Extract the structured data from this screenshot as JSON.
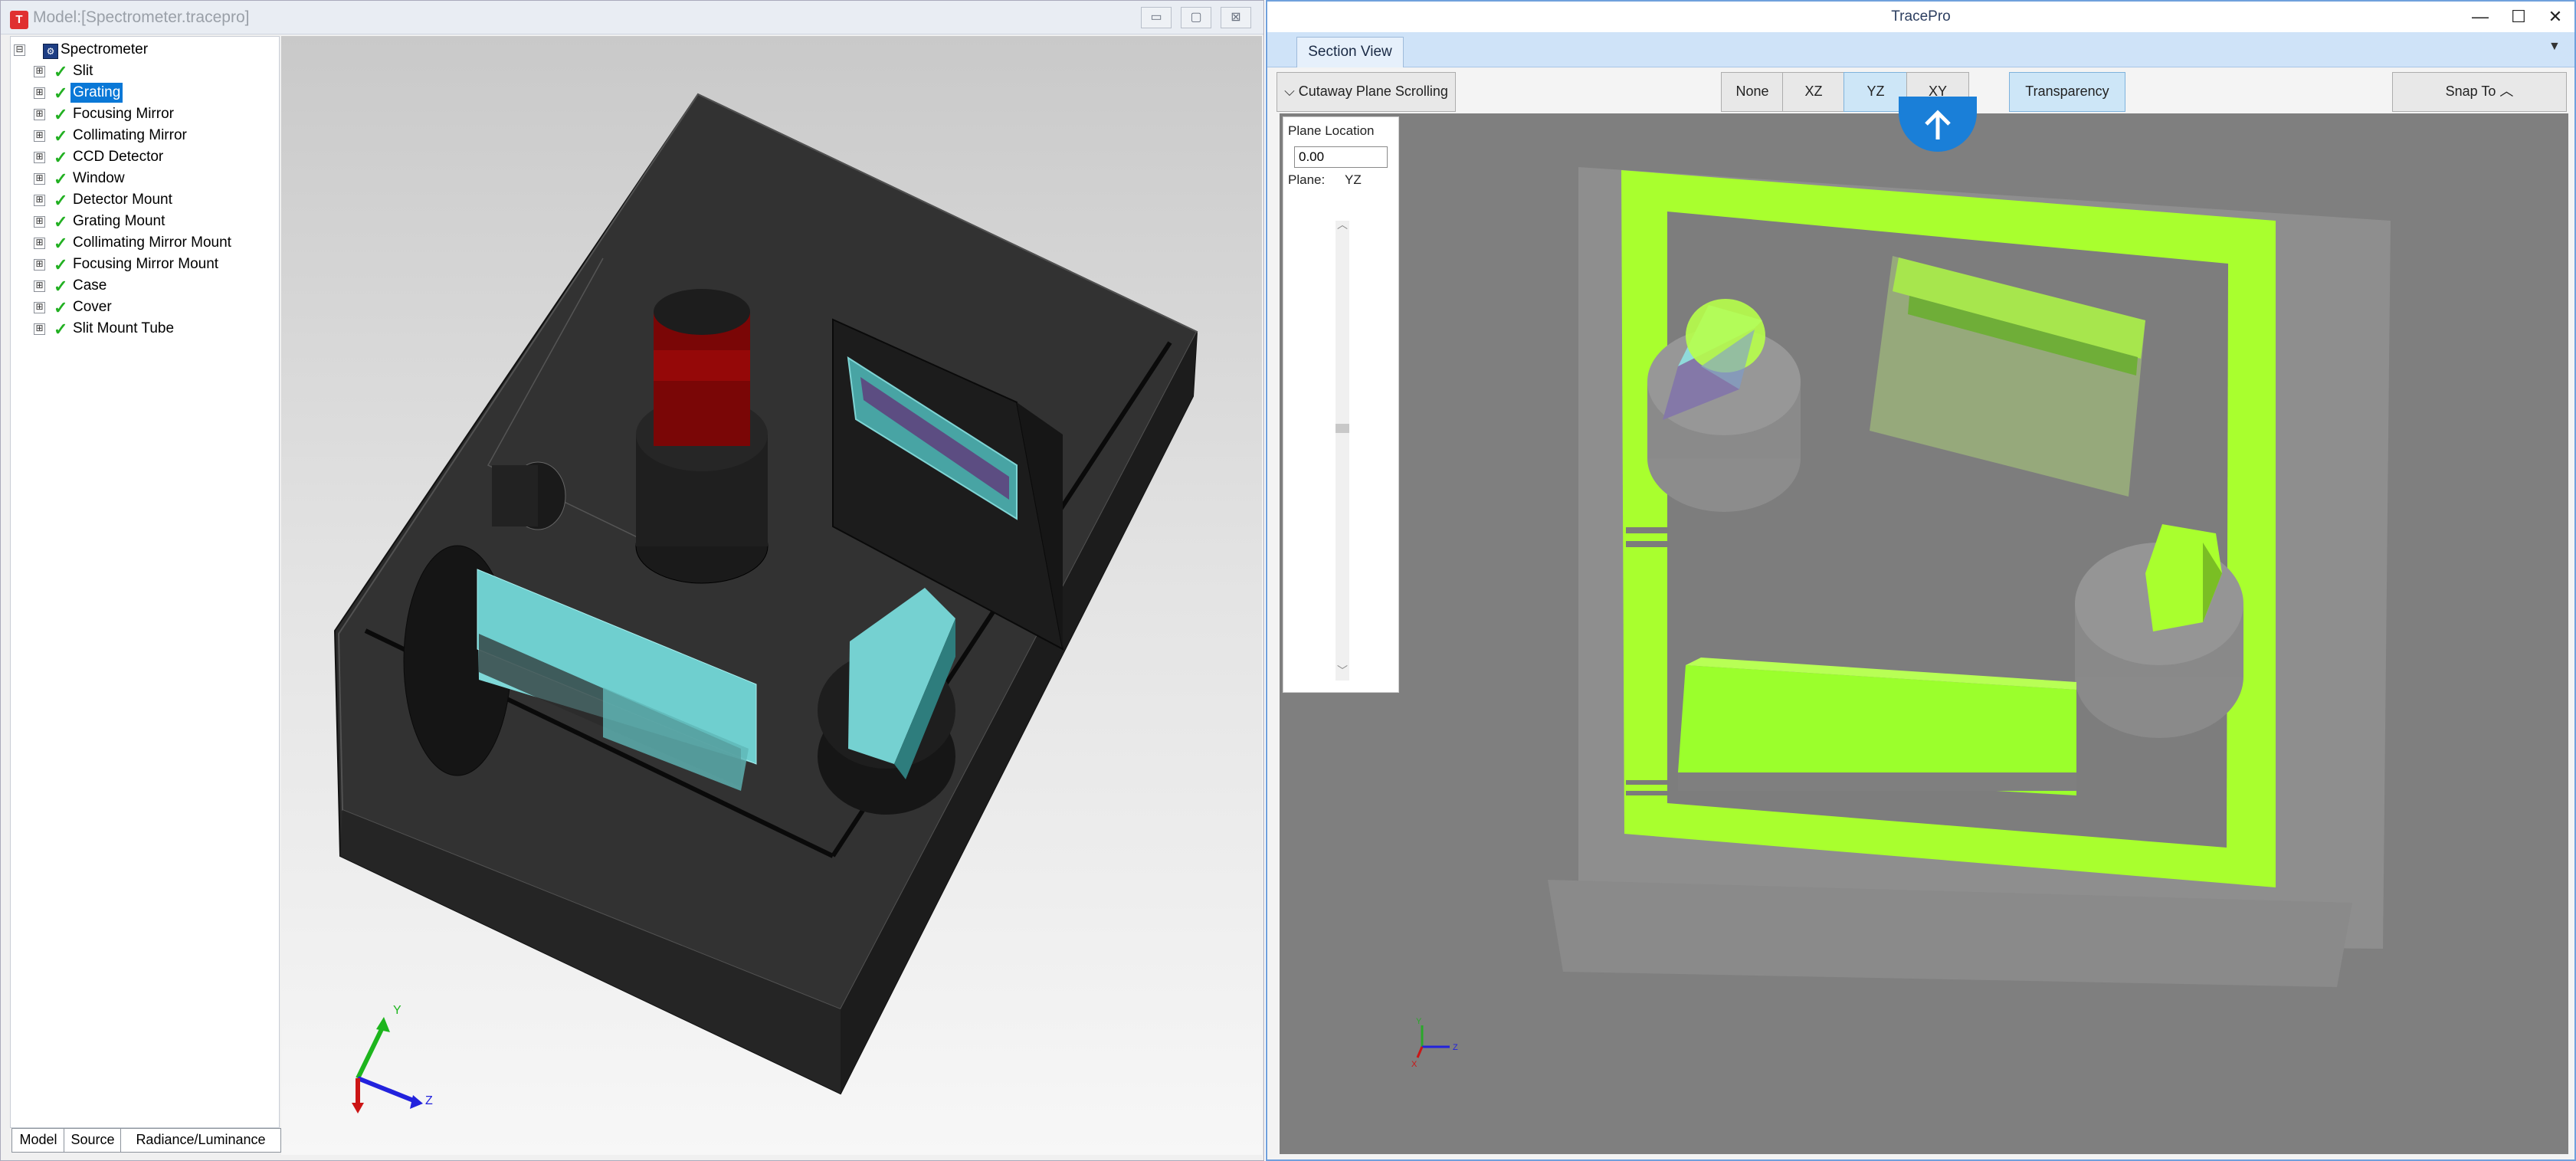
{
  "left_window": {
    "title": "Model:[Spectrometer.tracepro]",
    "app_icon": "tracepro-icon",
    "controls": {
      "minimize": "▭",
      "restore": "▢",
      "close": "⊠"
    }
  },
  "tree": {
    "root": "Spectrometer",
    "items": [
      {
        "label": "Slit",
        "selected": false
      },
      {
        "label": "Grating",
        "selected": true
      },
      {
        "label": "Focusing Mirror",
        "selected": false
      },
      {
        "label": "Collimating Mirror",
        "selected": false
      },
      {
        "label": "CCD Detector",
        "selected": false
      },
      {
        "label": "Window",
        "selected": false
      },
      {
        "label": "Detector Mount",
        "selected": false
      },
      {
        "label": "Grating Mount",
        "selected": false
      },
      {
        "label": "Collimating Mirror Mount",
        "selected": false
      },
      {
        "label": "Focusing Mirror Mount",
        "selected": false
      },
      {
        "label": "Case",
        "selected": false
      },
      {
        "label": "Cover",
        "selected": false
      },
      {
        "label": "Slit Mount Tube",
        "selected": false
      }
    ],
    "expander": "⊞",
    "root_expander": "⊟",
    "check": "✓"
  },
  "bottom_tabs": [
    "Model",
    "Source",
    "Radiance/Luminance"
  ],
  "left_axes": {
    "y": "Y",
    "z": "Z"
  },
  "right_window": {
    "title": "TracePro",
    "controls": {
      "minimize": "—",
      "maximize": "☐",
      "close": "✕"
    },
    "tab": "Section View",
    "tab_menu": "▼"
  },
  "toolbar": {
    "cutaway": "Cutaway Plane Scrolling",
    "cutaway_chevron": "⌵",
    "none": "None",
    "xz": "XZ",
    "yz": "YZ",
    "xy": "XY",
    "transparency": "Transparency",
    "snap": "Snap To",
    "snap_chevron": "︿"
  },
  "plane_panel": {
    "location_label": "Plane Location",
    "location_value": "0.00",
    "plane_label": "Plane:",
    "plane_value": "YZ",
    "up_arrow": "︿",
    "down_arrow": "﹀"
  },
  "right_axes": {
    "y": "Y",
    "z": "Z",
    "x": "X"
  },
  "colors": {
    "selection": "#0a78d7",
    "check": "#22b022",
    "section_green": "#a8ff2a",
    "accent_blue": "#1a7fd8"
  }
}
